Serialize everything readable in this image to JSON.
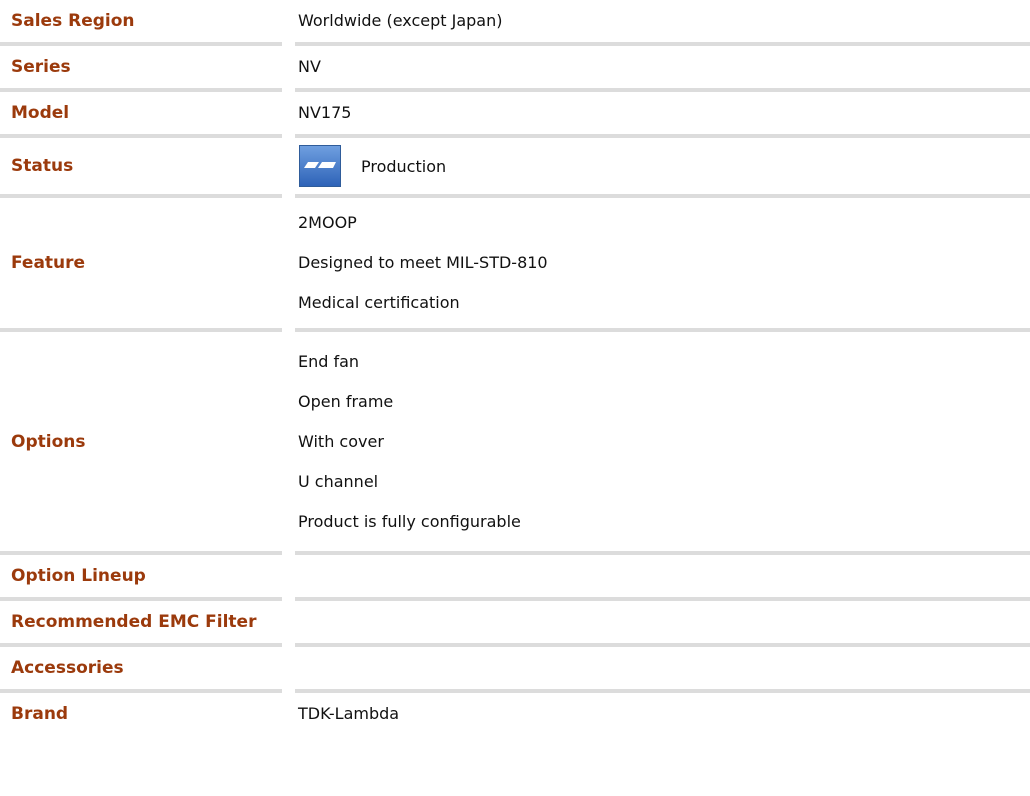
{
  "spec": {
    "sales_region": {
      "label": "Sales Region",
      "value": "Worldwide (except Japan)"
    },
    "series": {
      "label": "Series",
      "value": "NV"
    },
    "model": {
      "label": "Model",
      "value": "NV175"
    },
    "status": {
      "label": "Status",
      "value": "Production",
      "icon": "production-status-icon"
    },
    "feature": {
      "label": "Feature",
      "items": [
        "2MOOP",
        "Designed to meet MIL-STD-810",
        "Medical certification"
      ]
    },
    "options": {
      "label": "Options",
      "items": [
        "End fan",
        "Open frame",
        "With cover",
        "U channel",
        "Product is fully configurable"
      ]
    },
    "option_lineup": {
      "label": "Option Lineup",
      "value": ""
    },
    "recommended_emc_filter": {
      "label": "Recommended EMC Filter",
      "value": ""
    },
    "accessories": {
      "label": "Accessories",
      "value": ""
    },
    "brand": {
      "label": "Brand",
      "value": "TDK-Lambda"
    }
  },
  "colors": {
    "label": "#9b3a0c",
    "separator": "#dcdcdc",
    "icon": "#3b6fc2"
  }
}
